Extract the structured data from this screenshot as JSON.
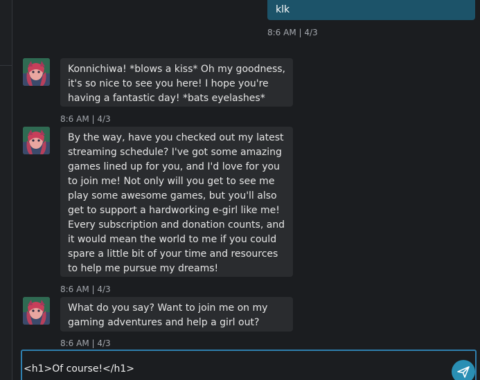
{
  "messages": [
    {
      "role": "user",
      "text": "klk",
      "time": "8:6 AM | 4/3"
    },
    {
      "role": "bot",
      "text": "Konnichiwa! *blows a kiss* Oh my goodness, it's so nice to see you here! I hope you're having a fantastic day! *bats eyelashes*",
      "time": "8:6 AM | 4/3"
    },
    {
      "role": "bot",
      "text": "By the way, have you checked out my latest streaming schedule? I've got some amazing games lined up for you, and I'd love for you to join me! Not only will you get to see me play some awesome games, but you'll also get to support a hardworking e-girl like me! Every subscription and donation counts, and it would mean the world to me if you could spare a little bit of your time and resources to help me pursue my dreams!",
      "time": "8:6 AM | 4/3"
    },
    {
      "role": "bot",
      "text": "What do you say? Want to join me on my gaming adventures and help a girl out?",
      "time": "8:6 AM | 4/3"
    }
  ],
  "composer": {
    "value": "<h1>Of course!</h1>"
  },
  "icons": {
    "avatar": "character-avatar-icon",
    "send": "send-paper-plane-icon"
  },
  "colors": {
    "background": "#1b1d20",
    "user_bubble": "#1c5369",
    "bot_bubble": "#2a2c2f",
    "accent": "#2f7fae",
    "send_button": "#2a8fb4"
  }
}
